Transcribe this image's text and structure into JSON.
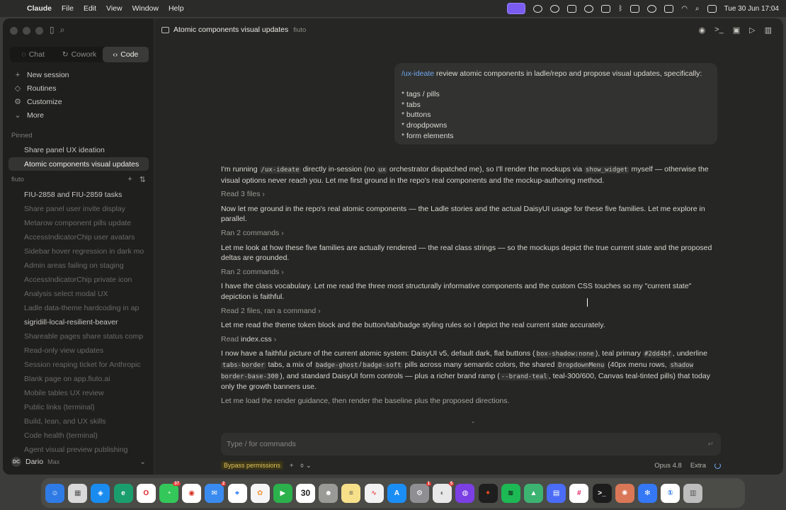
{
  "menubar": {
    "app_name": "Claude",
    "items": [
      "File",
      "Edit",
      "View",
      "Window",
      "Help"
    ],
    "clock": "Tue 30 Jun  17:04"
  },
  "sidebar": {
    "modes": [
      {
        "label": "Chat",
        "icon": "chat-icon"
      },
      {
        "label": "Cowork",
        "icon": "cowork-icon"
      },
      {
        "label": "Code",
        "icon": "code-icon",
        "active": true
      }
    ],
    "nav": [
      {
        "label": "New session",
        "icon": "plus-icon"
      },
      {
        "label": "Routines",
        "icon": "routine-icon"
      },
      {
        "label": "Customize",
        "icon": "customize-icon"
      },
      {
        "label": "More",
        "icon": "chevron-down-icon"
      }
    ],
    "pinned_label": "Pinned",
    "pinned": [
      {
        "label": "Share panel UX ideation"
      },
      {
        "label": "Atomic components visual updates",
        "active": true
      }
    ],
    "project_label": "fiuto",
    "sessions": [
      {
        "label": "FIU-2858 and FIU-2859 tasks",
        "bright": true
      },
      {
        "label": "Share panel user invite display"
      },
      {
        "label": "Metarow component pills update"
      },
      {
        "label": "AccessIndicatorChip user avatars"
      },
      {
        "label": "Sidebar hover regression in dark mo"
      },
      {
        "label": "Admin areas failing on staging"
      },
      {
        "label": "AccessIndicatorChip private icon"
      },
      {
        "label": "Analysis select modal UX"
      },
      {
        "label": "Ladle data-theme hardcoding in ap"
      },
      {
        "label": "sigridill-local-resilient-beaver",
        "bright": true
      },
      {
        "label": "Shareable pages share status comp"
      },
      {
        "label": "Read-only view updates"
      },
      {
        "label": "Session reaping ticket for Anthropic"
      },
      {
        "label": "Blank page on app.fiuto.ai"
      },
      {
        "label": "Mobile tables UX review"
      },
      {
        "label": "Public links (terminal)"
      },
      {
        "label": "Build, lean, and UX skills"
      },
      {
        "label": "Code health (terminal)"
      },
      {
        "label": "Agent visual preview publishing"
      }
    ],
    "user": {
      "initials": "DC",
      "name": "Dario",
      "plan": "Max"
    }
  },
  "topbar": {
    "title": "Atomic components visual updates",
    "project": "fiuto"
  },
  "user_message": {
    "command": "/ux-ideate",
    "text": " review atomic components in ladle/repo and propose visual updates, specifically:",
    "bullets": [
      "* tags / pills",
      "* tabs",
      "* buttons",
      "* dropdpowns",
      "* form elements"
    ]
  },
  "transcript": {
    "p1a": "I'm running ",
    "p1code1": "/ux-ideate",
    "p1b": " directly in-session (no ",
    "p1code2": "ux",
    "p1c": " orchestrator dispatched me), so I'll render the mockups via ",
    "p1code3": "show_widget",
    "p1d": " myself — otherwise the visual options never reach you. Let me first ground in the repo's real components and the mockup-authoring method.",
    "t1": "Read 3 files",
    "p2": "Now let me ground in the repo's real atomic components — the Ladle stories and the actual DaisyUI usage for these five families. Let me explore in parallel.",
    "t2": "Ran 2 commands",
    "p3": "Let me look at how these five families are actually rendered — the real class strings — so the mockups depict the true current state and the proposed deltas are grounded.",
    "t3": "Ran 2 commands",
    "p4": "I have the class vocabulary. Let me read the three most structurally informative components and the custom CSS touches so my \"current state\" depiction is faithful.",
    "t4": "Read 2 files, ran a command",
    "p5": "Let me read the theme token block and the button/tab/badge styling rules so I depict the real current state accurately.",
    "t5a": "Read ",
    "t5b": "index.css",
    "p6a": "I now have a faithful picture of the current atomic system: DaisyUI v5, default dark, flat buttons (",
    "p6c1": "box-shadow:none",
    "p6b": "), teal primary ",
    "p6c2": "#2dd4bf",
    "p6c": ", underline ",
    "p6c3": "tabs-border",
    "p6d": " tabs, a mix of ",
    "p6c4": "badge-ghost",
    "p6e": "/",
    "p6c5": "badge-soft",
    "p6f": " pills across many semantic colors, the shared ",
    "p6c6": "DropdownMenu",
    "p6g": " (40px menu rows, ",
    "p6c7": "shadow border-base-300",
    "p6h": "), and standard DaisyUI form controls — plus a richer brand ramp (",
    "p6c8": "--brand-teal",
    "p6i": ", teal-300/600, Canvas teal-tinted pills) that today only the growth banners use.",
    "p7": "Let me load the render guidance, then render the baseline plus the proposed directions."
  },
  "composer": {
    "placeholder": "Type / for commands",
    "bypass": "Bypass permissions",
    "model": "Opus 4.8",
    "effort": "Extra"
  },
  "dock": {
    "calendar_day": "30",
    "badge_messages": "37",
    "badge_mail": "2",
    "badge_settings": "1",
    "badge_other": "5"
  }
}
